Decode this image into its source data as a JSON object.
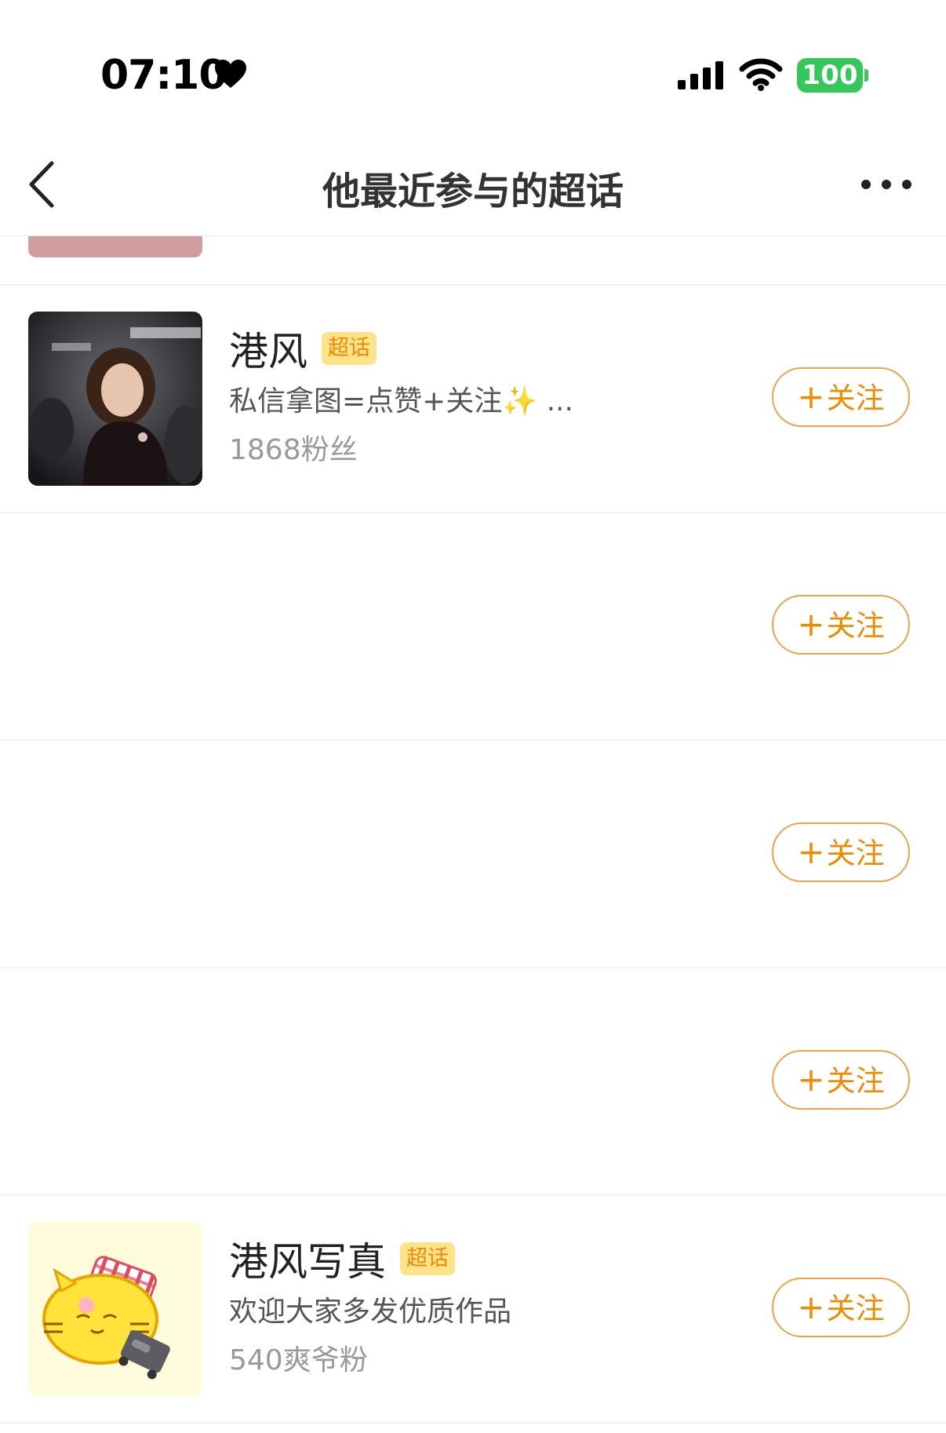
{
  "status_bar": {
    "time": "07:10",
    "battery": "100"
  },
  "nav": {
    "title": "他最近参与的超话"
  },
  "topics": [
    {
      "name": "港风",
      "tag": "超话",
      "description": "私信拿图=点赞+关注✨ ...",
      "fans": "1868粉丝",
      "follow_label": "关注"
    },
    {
      "follow_label": "关注"
    },
    {
      "follow_label": "关注"
    },
    {
      "follow_label": "关注"
    },
    {
      "name": "港风写真",
      "tag": "超话",
      "description": "欢迎大家多发优质作品",
      "fans": "540爽爷粉",
      "follow_label": "关注"
    }
  ],
  "colors": {
    "accent": "#f08a00",
    "tag_bg": "#ffe38a",
    "battery": "#34c759"
  }
}
